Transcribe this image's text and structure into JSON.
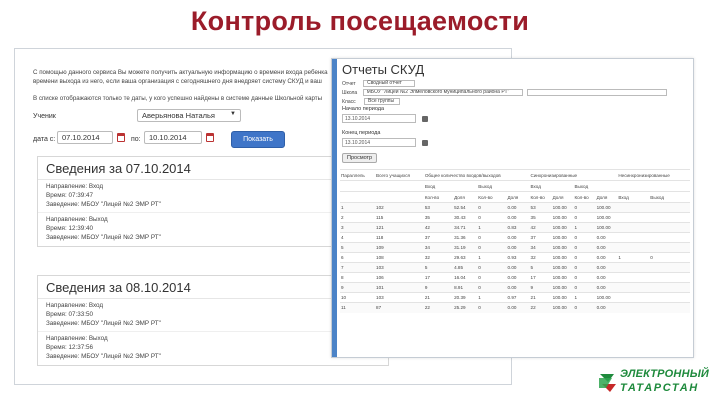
{
  "slide": {
    "title": "Контроль посещаемости"
  },
  "left_window": {
    "paragraphs": [
      "С помощью данного сервиса Вы можете получить актуальную информацию о времени входа ребенка",
      "времени выхода из него, если ваша организация с сегодняшнего дня внедряет систему СКУД и ваш",
      "В списке отображаются только те даты, у кого успешно найдены в системе данные Школьной карты"
    ],
    "child_label": "Ученик",
    "child_value": "Аверьянова Наталья",
    "date_from_label": "дата с:",
    "date_from": "07.10.2014",
    "date_to_label": "по:",
    "date_to": "10.10.2014",
    "show_button": "Показать",
    "days": [
      {
        "header": "Сведения за 07.10.2014",
        "records": [
          [
            "Направление: Вход",
            "Время: 07:39:47",
            "Заведение: МБОУ \"Лицей №2 ЭМР РТ\""
          ],
          [
            "Направление: Выход",
            "Время: 12:39:40",
            "Заведение: МБОУ \"Лицей №2 ЭМР РТ\""
          ]
        ]
      },
      {
        "header": "Сведения за 08.10.2014",
        "records": [
          [
            "Направление: Вход",
            "Время: 07:33:50",
            "Заведение: МБОУ \"Лицей №2 ЭМР РТ\""
          ],
          [
            "Направление: Выход",
            "Время: 12:37:56",
            "Заведение: МБОУ \"Лицей №2 ЭМР РТ\""
          ]
        ]
      }
    ]
  },
  "right_window": {
    "title": "Отчеты СКУД",
    "filters": [
      {
        "label": "Отчет",
        "value": "Сводный отчет"
      },
      {
        "label": "Школа",
        "value": "МБОУ \"Лицей №2 Элмеловского муниципального района РТ\""
      },
      {
        "label": "Класс",
        "value": "Все группы"
      }
    ],
    "start_label": "Начало периода",
    "start_value": "13.10.2014",
    "end_label": "Конец периода",
    "end_value": "13.10.2014",
    "view_button": "Просмотр",
    "table": {
      "headers": [
        "Параллель",
        "Всего учащихся",
        "Общее количество входов/выходов",
        "",
        "",
        "",
        "Синхронизированные",
        "",
        "",
        "",
        "Несинхронизированные",
        ""
      ],
      "subheaders": [
        "",
        "",
        "Вход",
        "",
        "Выход",
        "",
        "Вход",
        "",
        "Выход",
        "",
        "",
        ""
      ],
      "subheaders2": [
        "",
        "",
        "Кол-во",
        "Доля",
        "Кол-во",
        "Доля",
        "Кол-во",
        "Доля",
        "Кол-во",
        "Доля",
        "Вход",
        "Выход"
      ],
      "rows": [
        [
          "1",
          "102",
          "53",
          "52.54",
          "0",
          "0.00",
          "53",
          "100.00",
          "0",
          "100.00",
          "",
          ""
        ],
        [
          "2",
          "115",
          "35",
          "30.43",
          "0",
          "0.00",
          "35",
          "100.00",
          "0",
          "100.00",
          "",
          ""
        ],
        [
          "3",
          "121",
          "42",
          "34.71",
          "1",
          "0.83",
          "42",
          "100.00",
          "1",
          "100.00",
          "",
          ""
        ],
        [
          "4",
          "118",
          "37",
          "31.36",
          "0",
          "0.00",
          "37",
          "100.00",
          "0",
          "0.00",
          "",
          ""
        ],
        [
          "5",
          "109",
          "34",
          "31.19",
          "0",
          "0.00",
          "34",
          "100.00",
          "0",
          "0.00",
          "",
          ""
        ],
        [
          "6",
          "108",
          "32",
          "29.63",
          "1",
          "0.93",
          "32",
          "100.00",
          "0",
          "0.00",
          "1",
          "0"
        ],
        [
          "7",
          "103",
          "5",
          "4.85",
          "0",
          "0.00",
          "5",
          "100.00",
          "0",
          "0.00",
          "",
          ""
        ],
        [
          "8",
          "106",
          "17",
          "16.04",
          "0",
          "0.00",
          "17",
          "100.00",
          "0",
          "0.00",
          "",
          ""
        ],
        [
          "9",
          "101",
          "9",
          "8.91",
          "0",
          "0.00",
          "9",
          "100.00",
          "0",
          "0.00",
          "",
          ""
        ],
        [
          "10",
          "103",
          "21",
          "20.39",
          "1",
          "0.97",
          "21",
          "100.00",
          "1",
          "100.00",
          "",
          ""
        ],
        [
          "11",
          "87",
          "22",
          "25.29",
          "0",
          "0.00",
          "22",
          "100.00",
          "0",
          "0.00",
          "",
          ""
        ]
      ]
    }
  },
  "logo": {
    "line1": "ЭЛЕКТРОННЫЙ",
    "line2": "ТАТАРСТАН",
    "colors": {
      "green": "#1e8a3c",
      "red": "#c62828"
    }
  }
}
